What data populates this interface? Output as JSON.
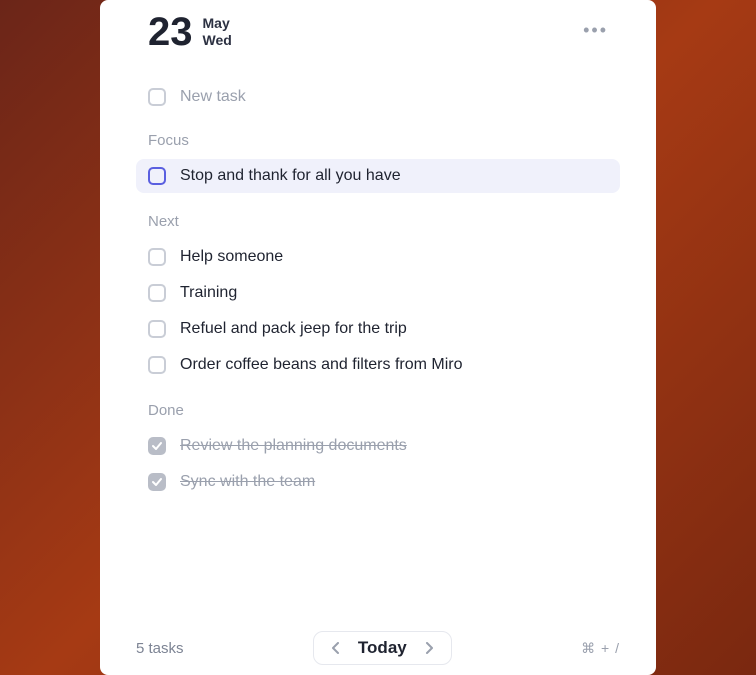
{
  "header": {
    "day_number": "23",
    "month": "May",
    "weekday": "Wed"
  },
  "new_task_placeholder": "New task",
  "sections": {
    "focus": {
      "label": "Focus",
      "tasks": [
        "Stop and thank for all you have"
      ]
    },
    "next": {
      "label": "Next",
      "tasks": [
        "Help someone",
        "Training",
        "Refuel and pack jeep for the trip",
        "Order coffee beans and filters from Miro"
      ]
    },
    "done": {
      "label": "Done",
      "tasks": [
        "Review the planning documents",
        "Sync with the team"
      ]
    }
  },
  "footer": {
    "task_count": "5 tasks",
    "today_label": "Today",
    "shortcut_hint": "⌘ + /"
  }
}
